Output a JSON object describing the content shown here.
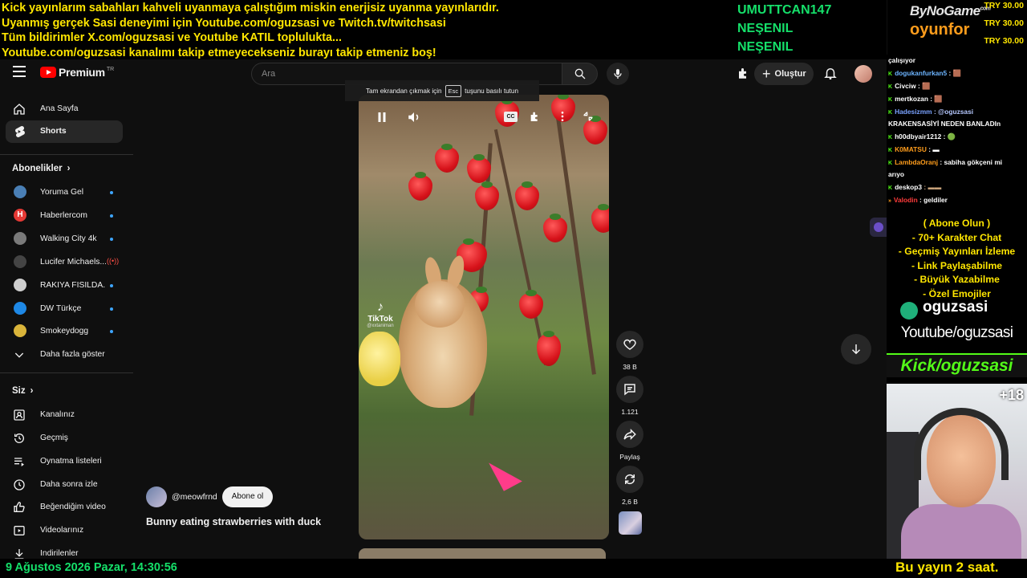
{
  "overlay": {
    "lines": [
      "Kick yayınlarım sabahları kahveli uyanmaya çalıştığım miskin enerjisiz uyanma yayınlarıdır.",
      "Uyanmış gerçek Sasi deneyimi için Youtube.com/oguzsasi ve Twitch.tv/twitchsasi",
      "Tüm bildirimler X.com/oguzsasi ve Youtube KATIL toplulukta...",
      "Youtube.com/oguzsasi kanalımı takip etmeyecekseniz burayı takip etmeniz boş!"
    ],
    "names": [
      "UMUTTCAN147",
      "NEŞENIL",
      "NEŞENIL"
    ],
    "brand_top": "ByNoGame",
    "brand_top_sup": "com",
    "brand_bottom": "oyunfor",
    "donations": [
      "TRY 30.00",
      "TRY 30.00",
      "TRY 30.00"
    ]
  },
  "youtube": {
    "logo_text": "Premium",
    "logo_sup": "TR",
    "search_placeholder": "Ara",
    "create_label": "Oluştur",
    "fullscreen_tip_before": "Tam ekrandan çıkmak için",
    "fullscreen_tip_key": "Esc",
    "fullscreen_tip_after": "tuşunu basılı tutun",
    "sidebar": {
      "main": [
        {
          "label": "Ana Sayfa",
          "icon": "home-icon"
        },
        {
          "label": "Shorts",
          "icon": "shorts-icon",
          "active": true
        }
      ],
      "subs_heading": "Abonelikler",
      "channels": [
        {
          "label": "Yoruma Gel",
          "color": "#4a7fb5",
          "indicator": "dot"
        },
        {
          "label": "Haberlercom",
          "color": "#e53935",
          "indicator": "dot"
        },
        {
          "label": "Walking City 4k",
          "color": "#7a7a7a",
          "indicator": "dot"
        },
        {
          "label": "Lucifer Michaels...",
          "color": "#444444",
          "indicator": "live"
        },
        {
          "label": "RAKIYA FISILDA...",
          "color": "#cfcfcf",
          "indicator": "dot"
        },
        {
          "label": "DW Türkçe",
          "color": "#1e88e5",
          "indicator": "dot"
        },
        {
          "label": "Smokeydogg",
          "color": "#d9b43a",
          "indicator": "dot"
        }
      ],
      "show_more": "Daha fazla göster",
      "you_heading": "Siz",
      "you_items": [
        {
          "label": "Kanalınız",
          "icon": "user-icon"
        },
        {
          "label": "Geçmiş",
          "icon": "history-icon"
        },
        {
          "label": "Oynatma listeleri",
          "icon": "playlist-icon"
        },
        {
          "label": "Daha sonra izle",
          "icon": "clock-icon"
        },
        {
          "label": "Beğendiğim videolar",
          "icon": "thumbs-up-icon"
        },
        {
          "label": "Videolarınız",
          "icon": "video-icon"
        },
        {
          "label": "İndirilenler",
          "icon": "download-icon"
        }
      ]
    },
    "short": {
      "channel": "@meowfrnd",
      "subscribe_label": "Abone ol",
      "title": "Bunny eating strawberries with duck",
      "watermark": "TikTok",
      "watermark_user": "@xxtaniman",
      "cc_label": "CC",
      "likes": "38 B",
      "comments": "1.121",
      "share_label": "Paylaş",
      "remix": "2,6 B"
    }
  },
  "chat": {
    "messages": [
      {
        "user": "",
        "text": "çalışıyor",
        "color": "#ffffff"
      },
      {
        "user": "dogukanfurkan5",
        "text": ": 🟫",
        "color": "#6cb4ff"
      },
      {
        "user": "Civciw",
        "text": ": 🟫",
        "color": "#ffffff"
      },
      {
        "user": "mertkozan",
        "text": ": 🟫",
        "color": "#ffffff"
      },
      {
        "user": "Hadesizmm",
        "text": ": @oguzsasi",
        "color": "#7aa2ff"
      },
      {
        "user": "",
        "text": "KRAKENSASİYİ NEDEN BANLADIn",
        "color": "#ffffff"
      },
      {
        "user": "h00dbyair1212",
        "text": ": 🟢",
        "color": "#ffffff"
      },
      {
        "user": "K0MATSU",
        "text": ": ▬",
        "color": "#ff9d1c"
      },
      {
        "user": "LambdaOranj",
        "text": ": sabiha gökçeni mi",
        "color": "#ff9d1c"
      },
      {
        "user": "",
        "text": "arıyo",
        "color": "#ffffff"
      },
      {
        "user": "deskop3",
        "text": ": ▬▬",
        "color": "#ffffff"
      },
      {
        "user": "Valodin",
        "text": ": geldiler",
        "color": "#ff3b3b"
      }
    ]
  },
  "promo": {
    "lines": [
      "( Abone Olun )",
      "- 70+ Karakter Chat",
      "- Geçmiş Yayınları İzleme",
      "- Link Paylaşabilme",
      "- Büyük Yazabilme",
      "- Özel Emojiler"
    ],
    "handle": "oguzsasi",
    "youtube": "Youtube/oguzsasi",
    "kick": "Kick/oguzsasi",
    "age_badge": "+18"
  },
  "ticker": {
    "date": "9 Ağustos 2026 Pazar, 14:30:56",
    "right": "Bu yayın 2 saat."
  }
}
